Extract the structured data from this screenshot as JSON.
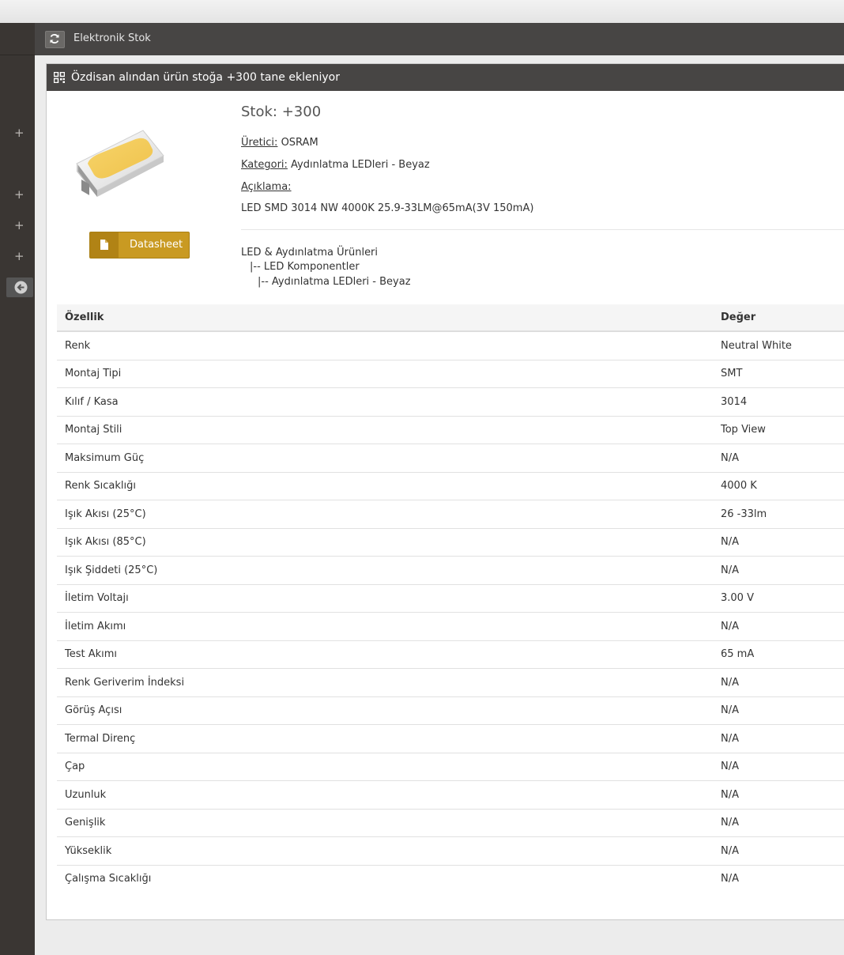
{
  "navbar": {
    "title": "Elektronik Stok",
    "refresh_icon": "refresh-icon"
  },
  "sidebar": {
    "plus_label": "+",
    "collapse_icon": "arrow-left-circle-icon"
  },
  "panel": {
    "title": "Özdisan alından ürün stoğa +300 tane ekleniyor",
    "header_icon": "qrcode-icon"
  },
  "product": {
    "stock": "Stok: +300",
    "manufacturer_label": "Üretici:",
    "manufacturer": "OSRAM",
    "category_label": "Kategori:",
    "category": "Aydınlatma LEDleri - Beyaz",
    "description_label": "Açıklama:",
    "description": "LED SMD 3014 NW 4000K 25.9-33LM@65mA(3V 150mA)",
    "datasheet_label": "Datasheet",
    "category_tree": [
      "LED & Aydınlatma Ürünleri",
      "|-- LED Komponentler",
      "|-- Aydınlatma LEDleri - Beyaz"
    ]
  },
  "specs": {
    "headers": [
      "Özellik",
      "Değer"
    ],
    "rows": [
      [
        "Renk",
        "Neutral White"
      ],
      [
        "Montaj Tipi",
        "SMT"
      ],
      [
        "Kılıf / Kasa",
        "3014"
      ],
      [
        "Montaj Stili",
        "Top View"
      ],
      [
        "Maksimum Güç",
        "N/A"
      ],
      [
        "Renk Sıcaklığı",
        "4000 K"
      ],
      [
        "Işık Akısı (25°C)",
        "26 -33lm"
      ],
      [
        "Işık Akısı (85°C)",
        "N/A"
      ],
      [
        "Işık Şiddeti (25°C)",
        "N/A"
      ],
      [
        "İletim Voltajı",
        "3.00 V"
      ],
      [
        "İletim Akımı",
        "N/A"
      ],
      [
        "Test Akımı",
        "65 mA"
      ],
      [
        "Renk Geriverim İndeksi",
        "N/A"
      ],
      [
        "Görüş Açısı",
        "N/A"
      ],
      [
        "Termal Direnç",
        "N/A"
      ],
      [
        "Çap",
        "N/A"
      ],
      [
        "Uzunluk",
        "N/A"
      ],
      [
        "Genişlik",
        "N/A"
      ],
      [
        "Yükseklik",
        "N/A"
      ],
      [
        "Çalışma Sıcaklığı",
        "N/A"
      ]
    ]
  }
}
